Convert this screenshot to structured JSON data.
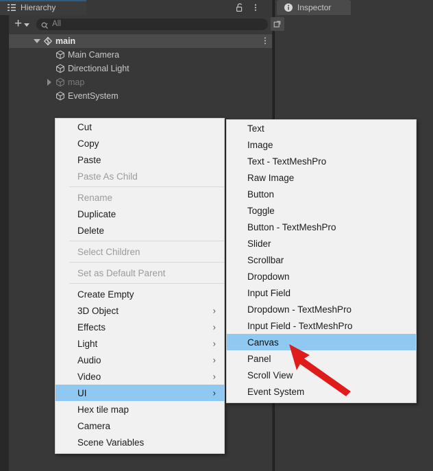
{
  "window": {
    "background_color": "#383838",
    "accent_blue": "#2c5d87",
    "menu_bg": "#f1f1f1",
    "menu_highlight": "#8fc9f2",
    "annotation_color": "#e01b1b"
  },
  "tabs": [
    {
      "label": "Hierarchy",
      "icon": "hierarchy-icon",
      "active": true
    },
    {
      "label": "Inspector",
      "icon": "info-icon",
      "active": false
    }
  ],
  "hierarchy_panel": {
    "tools": [
      {
        "name": "lock-icon",
        "glyph": "unlocked-padlock"
      },
      {
        "name": "kebab-menu-icon",
        "glyph": "three-vertical-dots"
      }
    ],
    "toolbar": {
      "add_button_label": "+",
      "add_button_caret": "▾",
      "search_placeholder": "All",
      "search_value": "",
      "search_icon": "search-icon",
      "expand_icon": "expand-search-icon"
    },
    "tree": [
      {
        "label": "main",
        "depth": 0,
        "foldout": "down",
        "icon": "unity-scene-icon",
        "dim": false,
        "scene": true,
        "kebab": true
      },
      {
        "label": "Main Camera",
        "depth": 1,
        "foldout": "none",
        "icon": "gameobject-icon",
        "dim": false,
        "scene": false,
        "kebab": false
      },
      {
        "label": "Directional Light",
        "depth": 1,
        "foldout": "none",
        "icon": "gameobject-icon",
        "dim": false,
        "scene": false,
        "kebab": false
      },
      {
        "label": "map",
        "depth": 1,
        "foldout": "right",
        "icon": "gameobject-icon",
        "dim": true,
        "scene": false,
        "kebab": false
      },
      {
        "label": "EventSystem",
        "depth": 1,
        "foldout": "none",
        "icon": "gameobject-icon",
        "dim": false,
        "scene": false,
        "kebab": false
      }
    ]
  },
  "context_menu": {
    "items": [
      {
        "label": "Cut",
        "type": "item",
        "disabled": false,
        "submenu": false,
        "selected": false
      },
      {
        "label": "Copy",
        "type": "item",
        "disabled": false,
        "submenu": false,
        "selected": false
      },
      {
        "label": "Paste",
        "type": "item",
        "disabled": false,
        "submenu": false,
        "selected": false
      },
      {
        "label": "Paste As Child",
        "type": "item",
        "disabled": true,
        "submenu": false,
        "selected": false
      },
      {
        "label": "",
        "type": "separator",
        "disabled": false,
        "submenu": false,
        "selected": false
      },
      {
        "label": "Rename",
        "type": "item",
        "disabled": true,
        "submenu": false,
        "selected": false
      },
      {
        "label": "Duplicate",
        "type": "item",
        "disabled": false,
        "submenu": false,
        "selected": false
      },
      {
        "label": "Delete",
        "type": "item",
        "disabled": false,
        "submenu": false,
        "selected": false
      },
      {
        "label": "",
        "type": "separator",
        "disabled": false,
        "submenu": false,
        "selected": false
      },
      {
        "label": "Select Children",
        "type": "item",
        "disabled": true,
        "submenu": false,
        "selected": false
      },
      {
        "label": "",
        "type": "separator",
        "disabled": false,
        "submenu": false,
        "selected": false
      },
      {
        "label": "Set as Default Parent",
        "type": "item",
        "disabled": true,
        "submenu": false,
        "selected": false
      },
      {
        "label": "",
        "type": "separator",
        "disabled": false,
        "submenu": false,
        "selected": false
      },
      {
        "label": "Create Empty",
        "type": "item",
        "disabled": false,
        "submenu": false,
        "selected": false
      },
      {
        "label": "3D Object",
        "type": "item",
        "disabled": false,
        "submenu": true,
        "selected": false
      },
      {
        "label": "Effects",
        "type": "item",
        "disabled": false,
        "submenu": true,
        "selected": false
      },
      {
        "label": "Light",
        "type": "item",
        "disabled": false,
        "submenu": true,
        "selected": false
      },
      {
        "label": "Audio",
        "type": "item",
        "disabled": false,
        "submenu": true,
        "selected": false
      },
      {
        "label": "Video",
        "type": "item",
        "disabled": false,
        "submenu": true,
        "selected": false
      },
      {
        "label": "UI",
        "type": "item",
        "disabled": false,
        "submenu": true,
        "selected": true
      },
      {
        "label": "Hex tile map",
        "type": "item",
        "disabled": false,
        "submenu": false,
        "selected": false
      },
      {
        "label": "Camera",
        "type": "item",
        "disabled": false,
        "submenu": false,
        "selected": false
      },
      {
        "label": "Scene Variables",
        "type": "item",
        "disabled": false,
        "submenu": false,
        "selected": false
      }
    ]
  },
  "submenu": {
    "parent": "UI",
    "items": [
      {
        "label": "Text",
        "disabled": false,
        "selected": false
      },
      {
        "label": "Image",
        "disabled": false,
        "selected": false
      },
      {
        "label": "Text - TextMeshPro",
        "disabled": false,
        "selected": false
      },
      {
        "label": "Raw Image",
        "disabled": false,
        "selected": false
      },
      {
        "label": "Button",
        "disabled": false,
        "selected": false
      },
      {
        "label": "Toggle",
        "disabled": false,
        "selected": false
      },
      {
        "label": "Button - TextMeshPro",
        "disabled": false,
        "selected": false
      },
      {
        "label": "Slider",
        "disabled": false,
        "selected": false
      },
      {
        "label": "Scrollbar",
        "disabled": false,
        "selected": false
      },
      {
        "label": "Dropdown",
        "disabled": false,
        "selected": false
      },
      {
        "label": "Input Field",
        "disabled": false,
        "selected": false
      },
      {
        "label": "Dropdown - TextMeshPro",
        "disabled": false,
        "selected": false
      },
      {
        "label": "Input Field - TextMeshPro",
        "disabled": false,
        "selected": false
      },
      {
        "label": "Canvas",
        "disabled": false,
        "selected": true
      },
      {
        "label": "Panel",
        "disabled": false,
        "selected": false
      },
      {
        "label": "Scroll View",
        "disabled": false,
        "selected": false
      },
      {
        "label": "Event System",
        "disabled": false,
        "selected": false
      }
    ]
  },
  "annotation": {
    "name": "red-arrow-pointing-to-canvas",
    "points_at": "Canvas",
    "color": "#e01b1b"
  }
}
